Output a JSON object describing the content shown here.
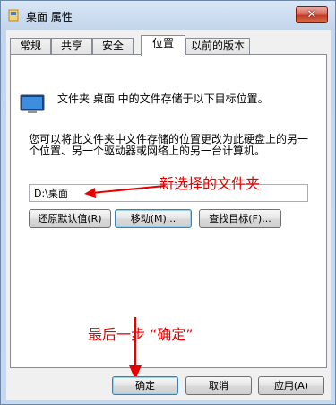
{
  "window": {
    "title": "桌面 属性",
    "close_symbol": "✕"
  },
  "tabs": [
    {
      "label": "常规"
    },
    {
      "label": "共享"
    },
    {
      "label": "安全"
    },
    {
      "label": "位置"
    },
    {
      "label": "以前的版本"
    }
  ],
  "location": {
    "description": "文件夹 桌面 中的文件存储于以下目标位置。",
    "paragraph": "您可以将此文件夹中文件存储的位置更改为此硬盘上的另一个位置、另一个驱动器或网络上的另一台计算机。",
    "path_value": "D:\\桌面",
    "restore_button": "还原默认值(R)",
    "move_button": "移动(M)...",
    "find_button": "查找目标(F)..."
  },
  "annotations": {
    "new_folder": "新选择的文件夹",
    "last_step": "最后一步 “确定”"
  },
  "footer": {
    "ok": "确定",
    "cancel": "取消",
    "apply": "应用(A)"
  },
  "colors": {
    "annotation": "#e60000",
    "close_button": "#c23b28"
  },
  "icons": [
    "folder-icon",
    "monitor-icon",
    "close-icon",
    "arrow-icon"
  ]
}
